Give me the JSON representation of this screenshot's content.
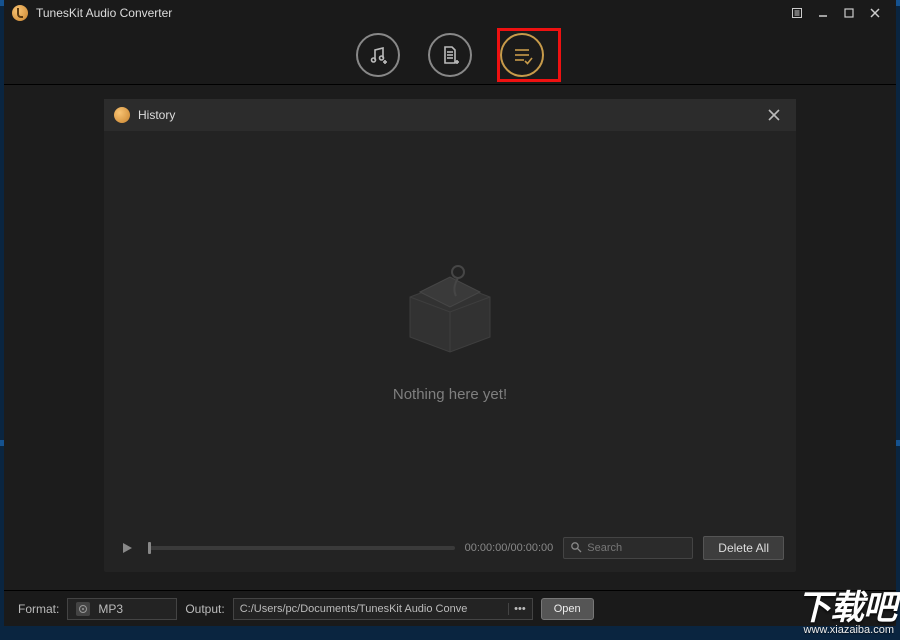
{
  "titlebar": {
    "title": "TunesKit Audio Converter"
  },
  "toolbar": {
    "items": [
      {
        "name": "add-music",
        "active": false
      },
      {
        "name": "add-file",
        "active": false
      },
      {
        "name": "history-list",
        "active": true
      }
    ],
    "highlight_index": 2
  },
  "panel": {
    "title": "History",
    "empty_text": "Nothing here yet!",
    "timecode": "00:00:00/00:00:00",
    "search_placeholder": "Search",
    "delete_all_label": "Delete All"
  },
  "bottombar": {
    "format_label": "Format:",
    "format_value": "MP3",
    "output_label": "Output:",
    "output_path": "C:/Users/pc/Documents/TunesKit Audio Conve",
    "open_label": "Open"
  },
  "watermark": {
    "big": "下载吧",
    "small": "www.xiazaiba.com"
  }
}
